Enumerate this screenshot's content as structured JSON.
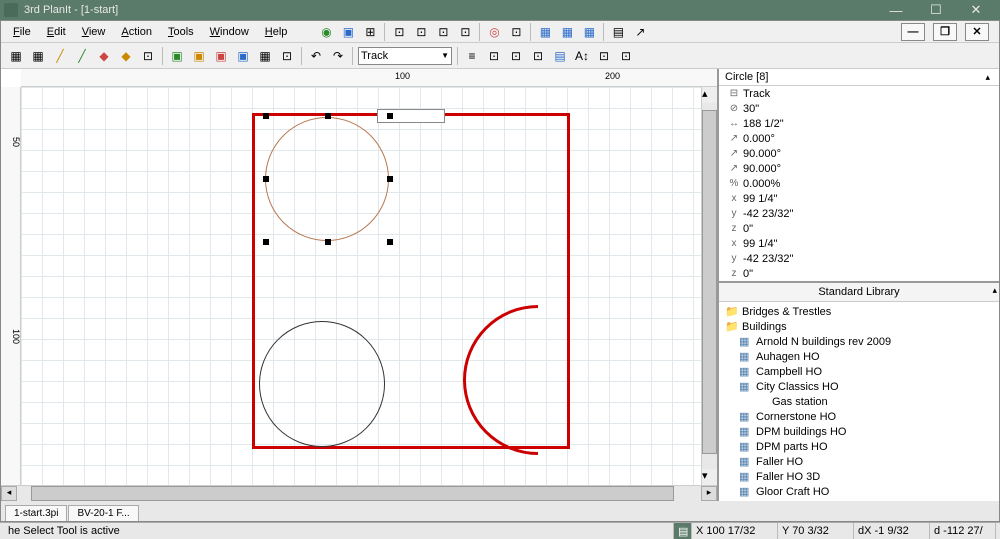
{
  "window": {
    "title": "3rd PlanIt - [1-start]"
  },
  "menu": {
    "file": "File",
    "edit": "Edit",
    "view": "View",
    "action": "Action",
    "tools": "Tools",
    "window": "Window",
    "help": "Help"
  },
  "toolbar": {
    "layer_combo": "Track"
  },
  "ruler": {
    "h1": "100",
    "h2": "200",
    "v1": "50",
    "v2": "100"
  },
  "props": {
    "title": "Circle [8]",
    "items": [
      {
        "icon": "⊟",
        "value": "Track"
      },
      {
        "icon": "⊘",
        "value": "30\""
      },
      {
        "icon": "↔",
        "value": "188 1/2\""
      },
      {
        "icon": "↗",
        "value": "0.000°"
      },
      {
        "icon": "↗",
        "value": "90.000°"
      },
      {
        "icon": "↗",
        "value": "90.000°"
      },
      {
        "icon": "%",
        "value": "0.000%"
      },
      {
        "icon": "x",
        "value": "99 1/4\""
      },
      {
        "icon": "y",
        "value": "-42 23/32\""
      },
      {
        "icon": "z",
        "value": "0\""
      },
      {
        "icon": "x",
        "value": "99 1/4\""
      },
      {
        "icon": "y",
        "value": "-42 23/32\""
      },
      {
        "icon": "z",
        "value": "0\""
      }
    ]
  },
  "lib": {
    "title": "Standard Library",
    "tree": [
      {
        "indent": 0,
        "type": "folder",
        "label": "Bridges & Trestles"
      },
      {
        "indent": 0,
        "type": "folder",
        "label": "Buildings"
      },
      {
        "indent": 1,
        "type": "file",
        "label": "Arnold N buildings rev 2009"
      },
      {
        "indent": 1,
        "type": "file",
        "label": "Auhagen HO"
      },
      {
        "indent": 1,
        "type": "file",
        "label": "Campbell HO"
      },
      {
        "indent": 1,
        "type": "file",
        "label": "City Classics HO"
      },
      {
        "indent": 2,
        "type": "none",
        "label": "Gas station"
      },
      {
        "indent": 1,
        "type": "file",
        "label": "Cornerstone HO"
      },
      {
        "indent": 1,
        "type": "file",
        "label": "DPM buildings HO"
      },
      {
        "indent": 1,
        "type": "file",
        "label": "DPM parts HO"
      },
      {
        "indent": 1,
        "type": "file",
        "label": "Faller HO"
      },
      {
        "indent": 1,
        "type": "file",
        "label": "Faller HO 3D"
      },
      {
        "indent": 1,
        "type": "file",
        "label": "Gloor Craft HO"
      }
    ]
  },
  "tabs": {
    "t1": "1-start.3pi",
    "t2": "BV-20-1 F..."
  },
  "status": {
    "msg": "he Select Tool is active",
    "x": "X 100 17/32",
    "y": "Y 70 3/32",
    "dx": "dX -1 9/32",
    "dy": "d -112 27/"
  }
}
